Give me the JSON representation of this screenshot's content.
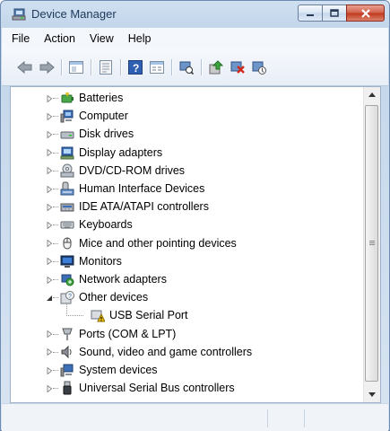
{
  "window": {
    "title": "Device Manager",
    "title_icon": "device-manager-icon"
  },
  "caption": {
    "minimize": "minimize-icon",
    "maximize": "maximize-icon",
    "close": "close-icon"
  },
  "menubar": {
    "items": [
      "File",
      "Action",
      "View",
      "Help"
    ]
  },
  "toolbar": {
    "buttons": [
      "back-icon",
      "forward-icon",
      "show-hide-console-tree-icon",
      "properties-icon",
      "help-icon",
      "view-icon",
      "scan-hardware-icon",
      "update-driver-icon",
      "uninstall-icon",
      "disable-icon"
    ]
  },
  "tree": {
    "items": [
      {
        "label": "Batteries",
        "icon": "battery-icon",
        "expanded": false,
        "level": 0
      },
      {
        "label": "Computer",
        "icon": "computer-icon",
        "expanded": false,
        "level": 0
      },
      {
        "label": "Disk drives",
        "icon": "disk-drive-icon",
        "expanded": false,
        "level": 0
      },
      {
        "label": "Display adapters",
        "icon": "display-adapter-icon",
        "expanded": false,
        "level": 0
      },
      {
        "label": "DVD/CD-ROM drives",
        "icon": "dvd-drive-icon",
        "expanded": false,
        "level": 0
      },
      {
        "label": "Human Interface Devices",
        "icon": "hid-icon",
        "expanded": false,
        "level": 0
      },
      {
        "label": "IDE ATA/ATAPI controllers",
        "icon": "ide-controller-icon",
        "expanded": false,
        "level": 0
      },
      {
        "label": "Keyboards",
        "icon": "keyboard-icon",
        "expanded": false,
        "level": 0
      },
      {
        "label": "Mice and other pointing devices",
        "icon": "mouse-icon",
        "expanded": false,
        "level": 0
      },
      {
        "label": "Monitors",
        "icon": "monitor-icon",
        "expanded": false,
        "level": 0
      },
      {
        "label": "Network adapters",
        "icon": "network-adapter-icon",
        "expanded": false,
        "level": 0
      },
      {
        "label": "Other devices",
        "icon": "unknown-device-icon",
        "expanded": true,
        "level": 0
      },
      {
        "label": "USB Serial Port",
        "icon": "warning-device-icon",
        "expanded": null,
        "level": 1
      },
      {
        "label": "Ports (COM & LPT)",
        "icon": "port-icon",
        "expanded": false,
        "level": 0
      },
      {
        "label": "Sound, video and game controllers",
        "icon": "sound-icon",
        "expanded": false,
        "level": 0
      },
      {
        "label": "System devices",
        "icon": "system-device-icon",
        "expanded": false,
        "level": 0
      },
      {
        "label": "Universal Serial Bus controllers",
        "icon": "usb-icon",
        "expanded": false,
        "level": 0
      }
    ]
  },
  "colors": {
    "title_text": "#1e395b",
    "close_button": "#c1361b",
    "panel_border": "#9fb1c8"
  }
}
